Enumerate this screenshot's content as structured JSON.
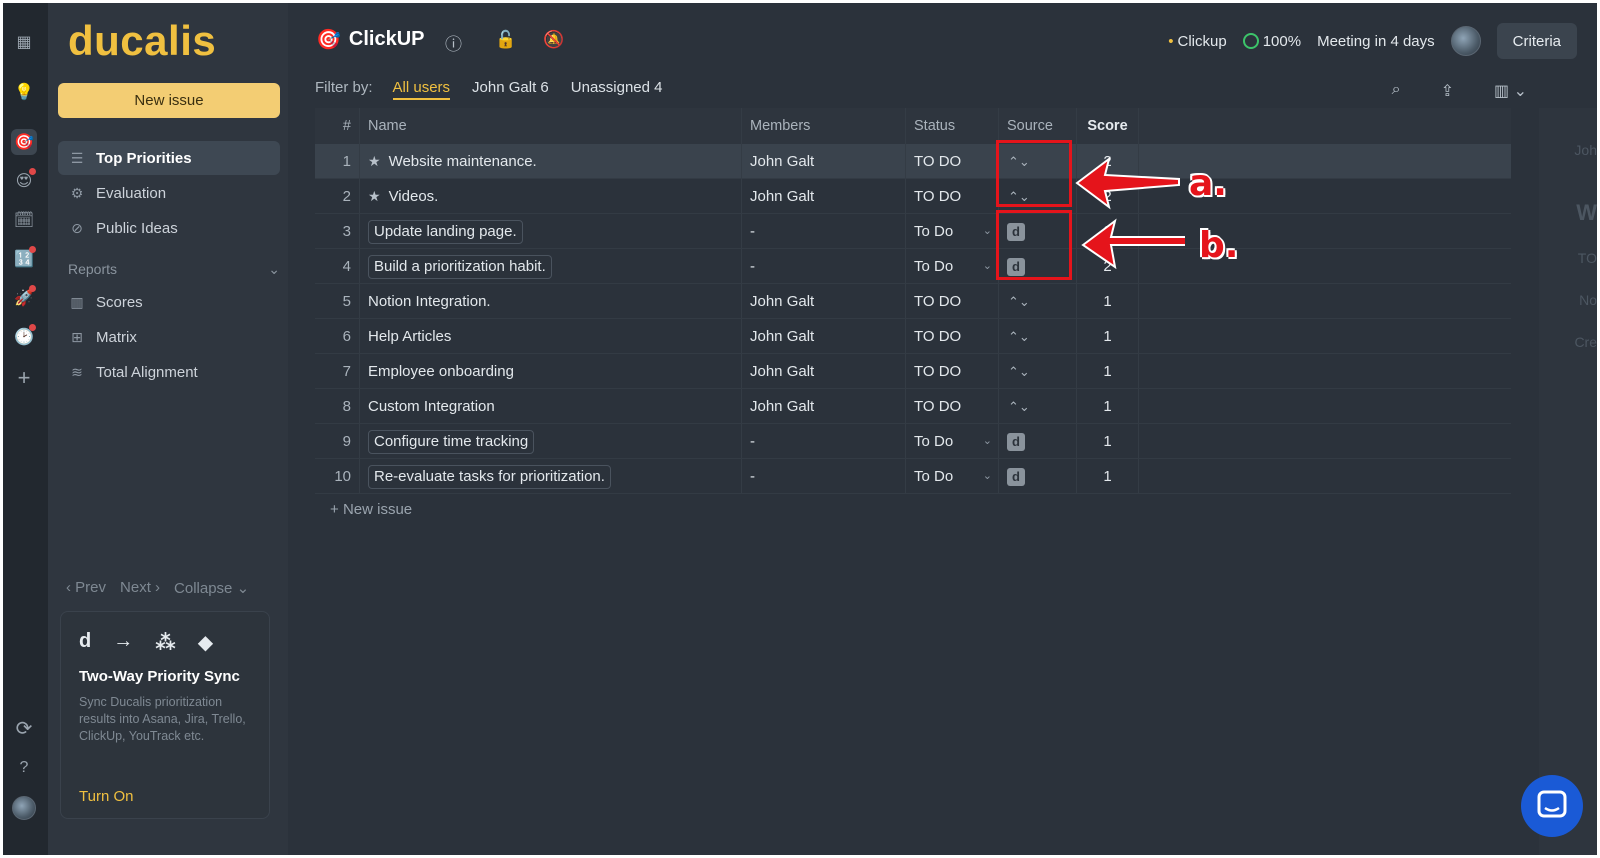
{
  "sidebar": {
    "logo": "ducalis",
    "new_issue": "New issue",
    "nav": [
      {
        "label": "Top Priorities",
        "icon": "list-icon"
      },
      {
        "label": "Evaluation",
        "icon": "nodes-icon"
      },
      {
        "label": "Public Ideas",
        "icon": "megaphone-off-icon"
      }
    ],
    "reports_label": "Reports",
    "reports": [
      {
        "label": "Scores",
        "icon": "columns-icon"
      },
      {
        "label": "Matrix",
        "icon": "grid-icon"
      },
      {
        "label": "Total Alignment",
        "icon": "layers-icon"
      }
    ],
    "pager": {
      "prev": "Prev",
      "next": "Next",
      "collapse": "Collapse"
    },
    "promo": {
      "title": "Two-Way Priority Sync",
      "description": "Sync Ducalis prioritization results into Asana, Jira, Trello, ClickUp, YouTrack etc.",
      "cta": "Turn On",
      "icons": [
        "d",
        "→",
        "⁂",
        "◆"
      ]
    }
  },
  "header": {
    "project": "ClickUP",
    "integration": "Clickup",
    "progress": "100%",
    "meeting": "Meeting in 4 days",
    "criteria": "Criteria"
  },
  "filter": {
    "label": "Filter by:",
    "options": [
      "All users",
      "John Galt 6",
      "Unassigned 4"
    ],
    "active": "All users"
  },
  "table": {
    "columns": [
      "#",
      "Name",
      "Members",
      "Status",
      "Source",
      "Score"
    ],
    "rows": [
      {
        "num": "1",
        "name": "Website maintenance.",
        "members": "John Galt",
        "status": "TO DO",
        "source": "clickup",
        "score": "2",
        "starred": true
      },
      {
        "num": "2",
        "name": "Videos.",
        "members": "John Galt",
        "status": "TO DO",
        "source": "clickup",
        "score": "2",
        "starred": true
      },
      {
        "num": "3",
        "name": "Update landing page.",
        "members": "-",
        "status": "To Do",
        "source": "ducalis",
        "score": "2",
        "starred": false
      },
      {
        "num": "4",
        "name": "Build a prioritization habit.",
        "members": "-",
        "status": "To Do",
        "source": "ducalis",
        "score": "2",
        "starred": false
      },
      {
        "num": "5",
        "name": "Notion Integration.",
        "members": "John Galt",
        "status": "TO DO",
        "source": "clickup",
        "score": "1",
        "starred": false
      },
      {
        "num": "6",
        "name": "Help Articles",
        "members": "John Galt",
        "status": "TO DO",
        "source": "clickup",
        "score": "1",
        "starred": false
      },
      {
        "num": "7",
        "name": "Employee onboarding",
        "members": "John Galt",
        "status": "TO DO",
        "source": "clickup",
        "score": "1",
        "starred": false
      },
      {
        "num": "8",
        "name": "Custom Integration",
        "members": "John Galt",
        "status": "TO DO",
        "source": "clickup",
        "score": "1",
        "starred": false
      },
      {
        "num": "9",
        "name": "Configure time tracking",
        "members": "-",
        "status": "To Do",
        "source": "ducalis",
        "score": "1",
        "starred": false
      },
      {
        "num": "10",
        "name": "Re-evaluate tasks for prioritization.",
        "members": "-",
        "status": "To Do",
        "source": "ducalis",
        "score": "1",
        "starred": false
      }
    ],
    "new_issue": "New issue"
  },
  "ghost_panel": [
    "Joh",
    "W",
    "TO",
    "No",
    "Cre"
  ],
  "annotations": {
    "a": "a.",
    "b": "b."
  },
  "colors": {
    "accent": "#f0c040",
    "annotation": "#e5141b",
    "background": "#2b323b"
  }
}
